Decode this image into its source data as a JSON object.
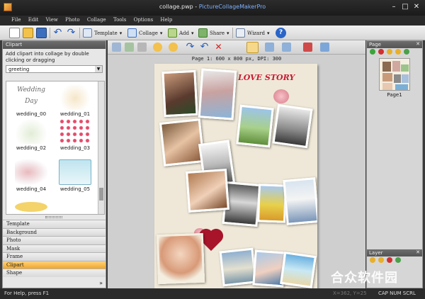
{
  "window": {
    "file": "collage.pwp",
    "sep": " - ",
    "app": "PictureCollageMakerPro"
  },
  "menu": [
    "File",
    "Edit",
    "View",
    "Photo",
    "Collage",
    "Tools",
    "Options",
    "Help"
  ],
  "toolbar": {
    "template": "Template",
    "collage": "Collage",
    "add": "Add",
    "share": "Share",
    "wizard": "Wizard"
  },
  "clipart": {
    "header": "Clipart",
    "description": "Add clipart into collage by double clicking or dragging",
    "category": "greeting",
    "items": [
      "wedding_00",
      "wedding_01",
      "wedding_02",
      "wedding_03",
      "wedding_04",
      "wedding_05"
    ],
    "wedding_day_text": "Wedding Day"
  },
  "tabs": [
    "Template",
    "Background",
    "Photo",
    "Mask",
    "Frame",
    "Clipart",
    "Shape"
  ],
  "active_tab": "Clipart",
  "canvas": {
    "page_info": "Page 1: 600 x 800 px, DPI: 300",
    "love_story": "LOVE STORY"
  },
  "page_panel": {
    "header": "Page",
    "page_label": "Page1"
  },
  "layer_panel": {
    "header": "Layer"
  },
  "status": {
    "help": "For Help, press F1",
    "coords": "X=362, Y=25",
    "caps": "CAP NUM SCRL"
  },
  "watermark": "合众软件园",
  "colors": {
    "active_tab": "#f0a62a",
    "title_text": "#c81a33",
    "accent": "#7fb2ff"
  }
}
